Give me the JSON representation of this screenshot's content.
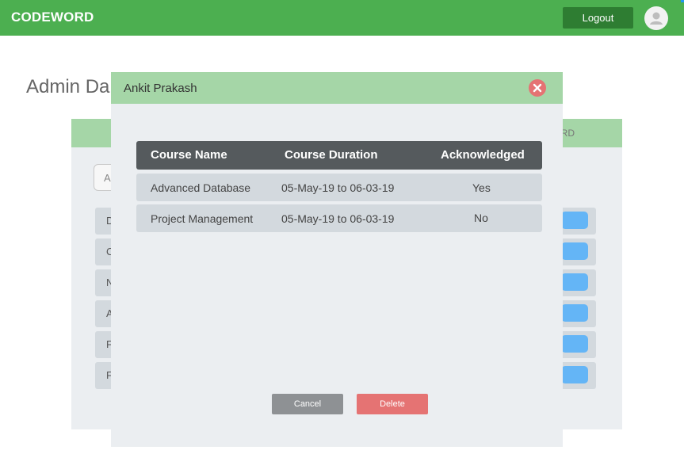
{
  "navbar": {
    "brand": "CODEWORD",
    "logout_label": "Logout",
    "accent": "#4caf50"
  },
  "background": {
    "page_title": "Admin Da",
    "header_fragment": "RD",
    "search_fragment": "A",
    "row_initials": [
      "D",
      "C",
      "N",
      "A",
      "F",
      "F"
    ]
  },
  "modal": {
    "title": "Ankit Prakash",
    "columns": [
      "Course Name",
      "Course Duration",
      "Acknowledged"
    ],
    "rows": [
      {
        "course_name": "Advanced Database",
        "duration": "05-May-19 to 06-03-19",
        "acknowledged": "Yes"
      },
      {
        "course_name": "Project Management",
        "duration": "05-May-19 to 06-03-19",
        "acknowledged": "No"
      }
    ],
    "cancel_label": "Cancel",
    "delete_label": "Delete"
  },
  "colors": {
    "header_green": "#a5d6a7",
    "danger": "#e57373",
    "table_header": "#555a5d"
  }
}
